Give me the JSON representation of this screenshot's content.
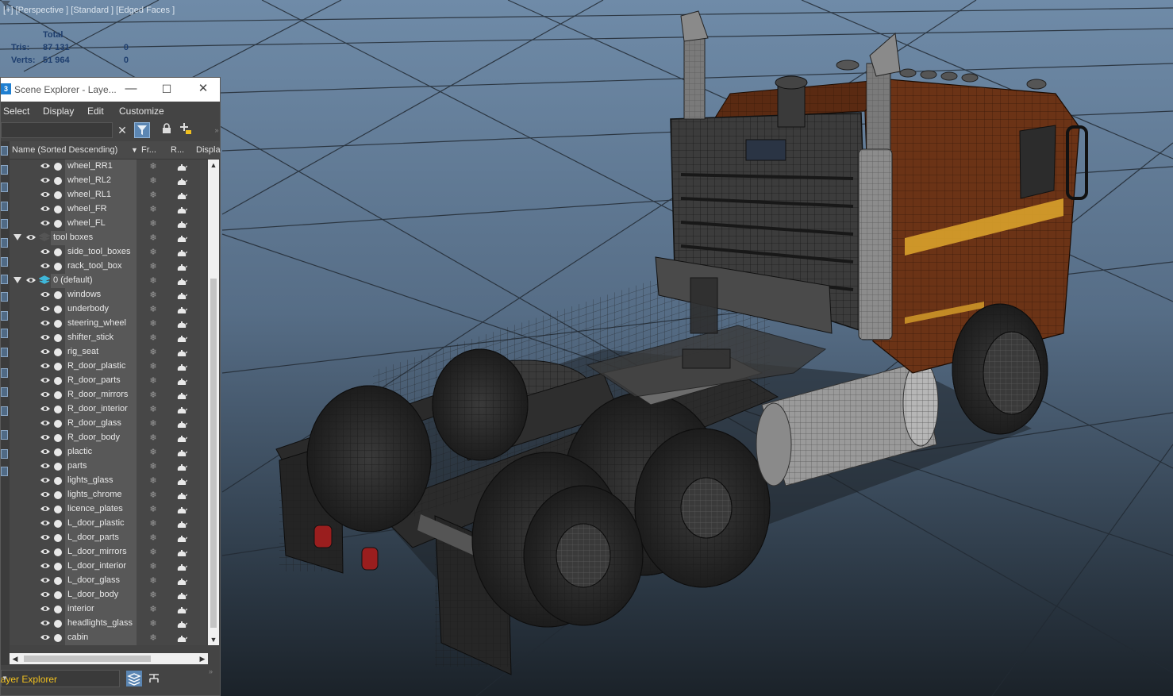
{
  "viewport": {
    "label": "[+] [Perspective ] [Standard ] [Edged Faces ]",
    "stats": {
      "header": "Total",
      "rows": [
        {
          "key": "Tris:",
          "total": "87 131",
          "selected": "0"
        },
        {
          "key": "Verts:",
          "total": "51 964",
          "selected": "0"
        }
      ]
    }
  },
  "explorer": {
    "app_icon": "3",
    "title": "Scene Explorer - Laye...",
    "window_buttons": {
      "minimize": "—",
      "maximize": "☐",
      "close": "✕"
    },
    "menu": [
      "Select",
      "Display",
      "Edit",
      "Customize"
    ],
    "columns": {
      "name": "Name (Sorted Descending)",
      "frozen": "Fr...",
      "render": "R...",
      "display": "Displa"
    },
    "rows": [
      {
        "label": "wheel_RR1",
        "type": "object"
      },
      {
        "label": "wheel_RL2",
        "type": "object"
      },
      {
        "label": "wheel_RL1",
        "type": "object"
      },
      {
        "label": "wheel_FR",
        "type": "object"
      },
      {
        "label": "wheel_FL",
        "type": "object"
      },
      {
        "label": "tool boxes",
        "type": "layer"
      },
      {
        "label": "side_tool_boxes",
        "type": "object"
      },
      {
        "label": "rack_tool_box",
        "type": "object"
      },
      {
        "label": "0 (default)",
        "type": "layer-active"
      },
      {
        "label": "windows",
        "type": "object"
      },
      {
        "label": "underbody",
        "type": "object"
      },
      {
        "label": "steering_wheel",
        "type": "object"
      },
      {
        "label": "shifter_stick",
        "type": "object"
      },
      {
        "label": "rig_seat",
        "type": "object"
      },
      {
        "label": "R_door_plastic",
        "type": "object"
      },
      {
        "label": "R_door_parts",
        "type": "object"
      },
      {
        "label": "R_door_mirrors",
        "type": "object"
      },
      {
        "label": "R_door_interior",
        "type": "object"
      },
      {
        "label": "R_door_glass",
        "type": "object"
      },
      {
        "label": "R_door_body",
        "type": "object"
      },
      {
        "label": "plactic",
        "type": "object"
      },
      {
        "label": "parts",
        "type": "object"
      },
      {
        "label": "lights_glass",
        "type": "object"
      },
      {
        "label": "lights_chrome",
        "type": "object"
      },
      {
        "label": "licence_plates",
        "type": "object"
      },
      {
        "label": "L_door_plastic",
        "type": "object"
      },
      {
        "label": "L_door_parts",
        "type": "object"
      },
      {
        "label": "L_door_mirrors",
        "type": "object"
      },
      {
        "label": "L_door_interior",
        "type": "object"
      },
      {
        "label": "L_door_glass",
        "type": "object"
      },
      {
        "label": "L_door_body",
        "type": "object"
      },
      {
        "label": "interior",
        "type": "object"
      },
      {
        "label": "headlights_glass",
        "type": "object"
      },
      {
        "label": "cabin",
        "type": "object"
      }
    ],
    "explorer_type": "Layer Explorer",
    "colors": {
      "accent": "#5b86b3",
      "cab": "#6b3316",
      "stripe": "#d9a12b",
      "highlight_text": "#f0c020"
    }
  }
}
